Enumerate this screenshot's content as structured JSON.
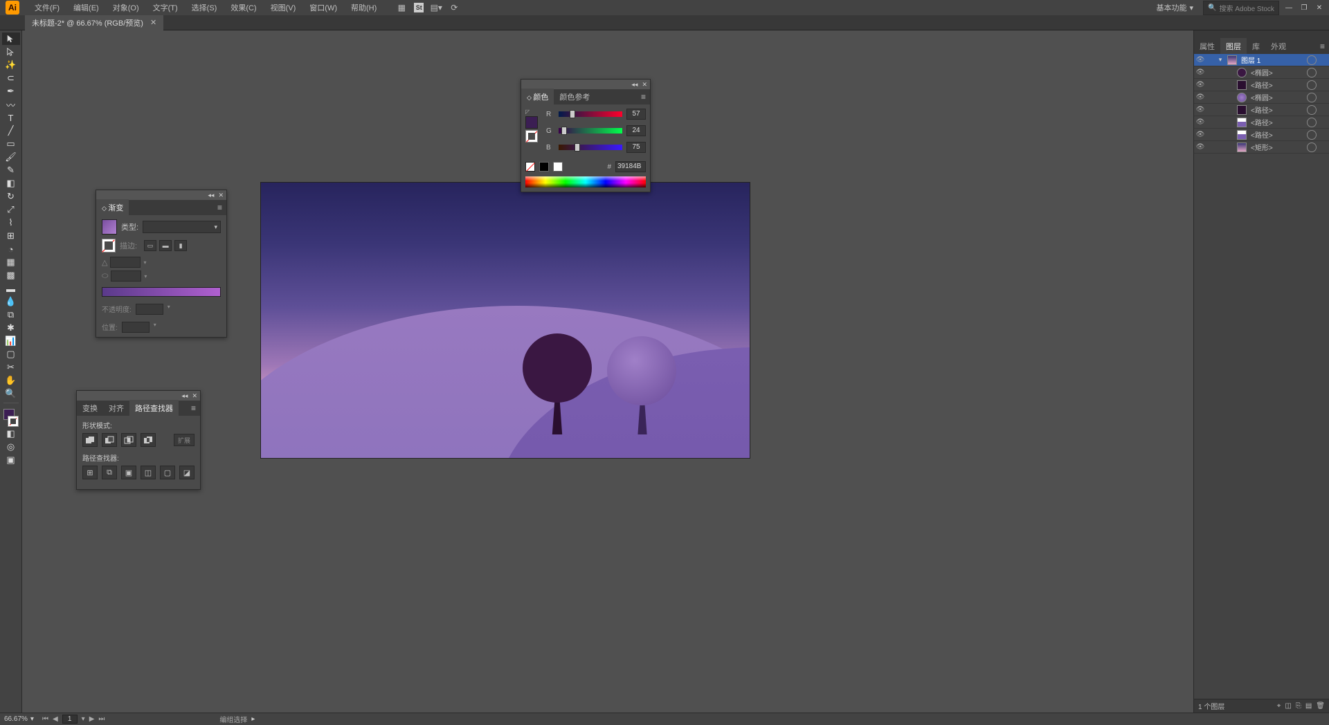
{
  "app": {
    "logo": "Ai"
  },
  "menu": {
    "file": "文件(F)",
    "edit": "编辑(E)",
    "object": "对象(O)",
    "type": "文字(T)",
    "select": "选择(S)",
    "effect": "效果(C)",
    "view": "视图(V)",
    "window": "窗口(W)",
    "help": "帮助(H)"
  },
  "workspace": {
    "label": "基本功能"
  },
  "search": {
    "placeholder": "搜索 Adobe Stock"
  },
  "doctab": {
    "title": "未标题-2* @ 66.67% (RGB/预览)"
  },
  "gradient": {
    "title": "渐变",
    "type_label": "类型:",
    "stroke_label": "描边:",
    "opacity_label": "不透明度:",
    "position_label": "位置:"
  },
  "color": {
    "tab_color": "颜色",
    "tab_guide": "颜色参考",
    "r_label": "R",
    "g_label": "G",
    "b_label": "B",
    "r_val": "57",
    "g_val": "24",
    "b_val": "75",
    "hex_label": "#",
    "hex_val": "39184B"
  },
  "pathfinder": {
    "tab_transform": "变换",
    "tab_align": "对齐",
    "tab_pathfinder": "路径查找器",
    "shape_modes": "形状模式:",
    "pathfinders": "路径查找器:",
    "expand": "扩展"
  },
  "rightdock": {
    "tab_props": "属性",
    "tab_layers": "图层",
    "tab_lib": "库",
    "tab_appearance": "外观",
    "layers": [
      {
        "name": "图层 1",
        "indent": 0,
        "thumb": "lt-grad",
        "expanded": true,
        "selected": true
      },
      {
        "name": "<椭圆>",
        "indent": 1,
        "thumb": "lt-dark"
      },
      {
        "name": "<路径>",
        "indent": 1,
        "thumb": "lt-trunk"
      },
      {
        "name": "<椭圆>",
        "indent": 1,
        "thumb": "lt-purp"
      },
      {
        "name": "<路径>",
        "indent": 1,
        "thumb": "lt-trunk"
      },
      {
        "name": "<路径>",
        "indent": 1,
        "thumb": "lt-path"
      },
      {
        "name": "<路径>",
        "indent": 1,
        "thumb": "lt-path"
      },
      {
        "name": "<矩形>",
        "indent": 1,
        "thumb": "lt-rect"
      }
    ],
    "footer": "1 个图层"
  },
  "status": {
    "zoom": "66.67%",
    "artboard": "1",
    "tool_hint": "编组选择"
  }
}
